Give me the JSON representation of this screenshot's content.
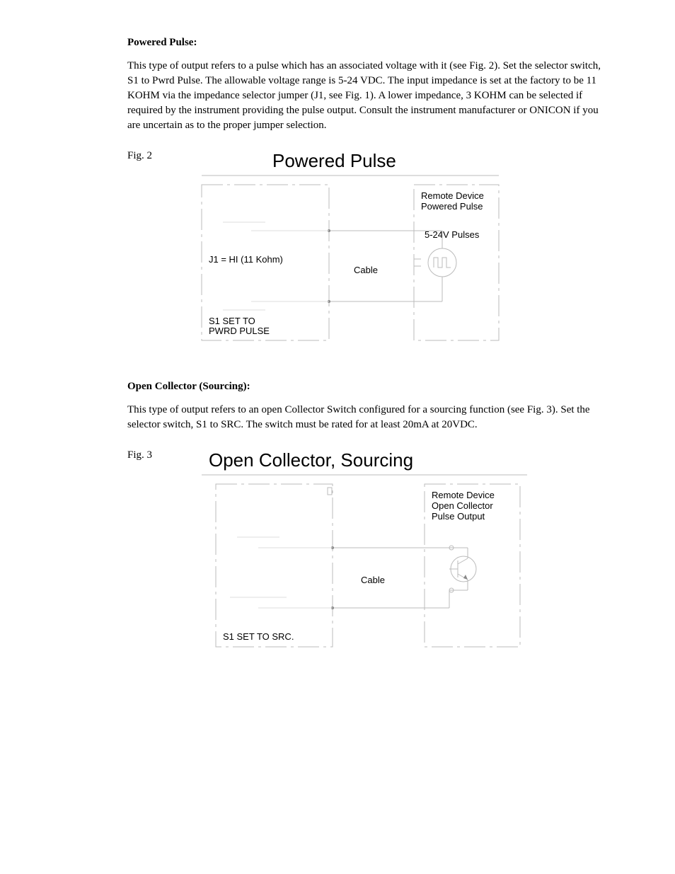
{
  "section1": {
    "heading": "Powered Pulse:",
    "paragraph": "This type of output refers to a pulse which has an associated voltage with it (see Fig. 2). Set the selector switch, S1 to Pwrd Pulse. The allowable voltage range is 5-24 VDC. The input impedance is set at the factory to be 11 KOHM via the impedance selector jumper (J1, see Fig. 1). A lower impedance, 3 KOHM can be selected if required by the instrument providing the pulse output. Consult the instrument manufacturer or ONICON if you are uncertain as to the proper jumper selection.",
    "fig_label": "Fig. 2",
    "diagram": {
      "title": "Powered Pulse",
      "remote_line1": "Remote Device",
      "remote_line2": "Powered Pulse",
      "pulses_label": "5-24V Pulses",
      "cable_label": "Cable",
      "j1_label": "J1 = HI (11 Kohm)",
      "s1_line1": "S1 SET TO",
      "s1_line2": "PWRD PULSE"
    }
  },
  "section2": {
    "heading": "Open Collector (Sourcing):",
    "paragraph": "This type of output refers to an open Collector Switch configured for a sourcing function (see Fig. 3). Set the selector switch, S1 to SRC. The switch must be rated for at least 20mA at 20VDC.",
    "fig_label": "Fig. 3",
    "diagram": {
      "title": "Open Collector, Sourcing",
      "remote_line1": "Remote Device",
      "remote_line2": "Open Collector",
      "remote_line3": "Pulse Output",
      "cable_label": "Cable",
      "s1_label": "S1 SET TO SRC."
    }
  }
}
